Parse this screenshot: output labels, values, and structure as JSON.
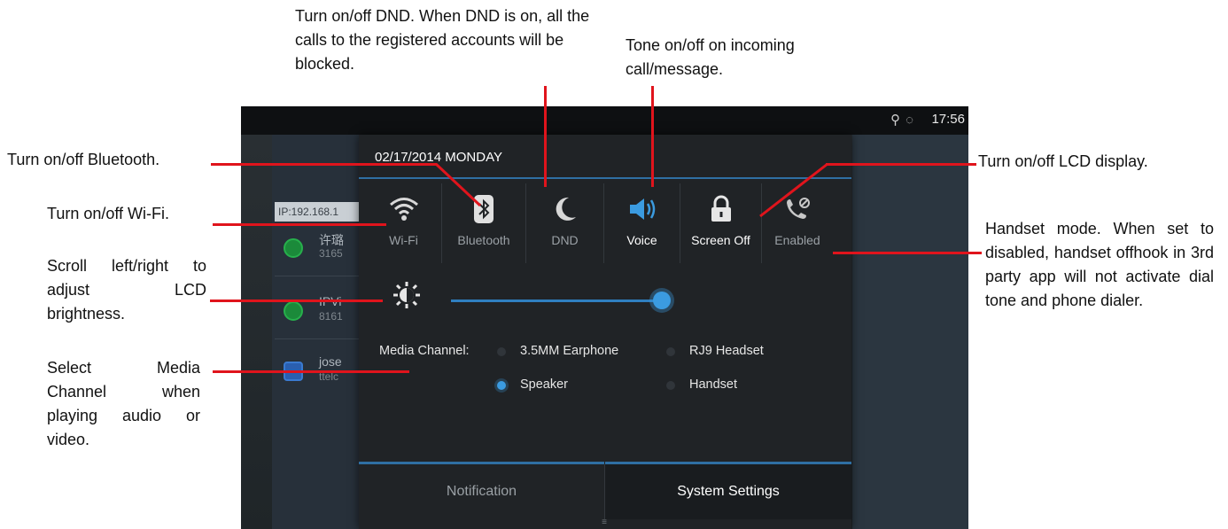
{
  "annotations": {
    "dnd": "Turn on/off DND. When DND is on, all the calls to the registered accounts will be blocked.",
    "voice": "Tone on/off on incoming call/message.",
    "bluetooth": "Turn on/off Bluetooth.",
    "wifi": "Turn on/off Wi-Fi.",
    "brightness": "Scroll left/right to adjust LCD brightness.",
    "media": "Select Media Channel when playing audio or video.",
    "lcd": "Turn on/off LCD display.",
    "handset": "Handset mode. When set to disabled, handset offhook in 3rd party app will not activate dial tone and phone dialer."
  },
  "status_bar": {
    "time": "17:56",
    "icons": [
      "usb-icon",
      "sync-icon"
    ]
  },
  "background_app": {
    "ip_label": "IP:192.168.1",
    "rows": [
      {
        "name": "许璐",
        "number": "3165"
      },
      {
        "name": "IPVi",
        "number": "8161"
      },
      {
        "name": "jose",
        "number": "ttelc"
      }
    ]
  },
  "panel": {
    "date": "02/17/2014 MONDAY",
    "tiles": [
      {
        "label": "Wi-Fi",
        "icon": "wifi-icon",
        "active": false
      },
      {
        "label": "Bluetooth",
        "icon": "bluetooth-icon",
        "active": false
      },
      {
        "label": "DND",
        "icon": "moon-icon",
        "active": false
      },
      {
        "label": "Voice",
        "icon": "speaker-icon",
        "active": true
      },
      {
        "label": "Screen Off",
        "icon": "lock-icon",
        "active": true
      },
      {
        "label": "Enabled",
        "icon": "handset-icon",
        "active": false
      }
    ],
    "brightness_level": 0.95,
    "media_channel": {
      "label": "Media Channel:",
      "options": [
        {
          "label": "3.5MM Earphone",
          "selected": false
        },
        {
          "label": "RJ9 Headset",
          "selected": false
        },
        {
          "label": "Speaker",
          "selected": true
        },
        {
          "label": "Handset",
          "selected": false
        }
      ]
    },
    "tabs": [
      {
        "label": "Notification",
        "active": false
      },
      {
        "label": "System Settings",
        "active": true
      }
    ]
  },
  "colors": {
    "accent": "#3b9be0",
    "callout_line": "#e0141c",
    "panel_bg": "#202326"
  }
}
